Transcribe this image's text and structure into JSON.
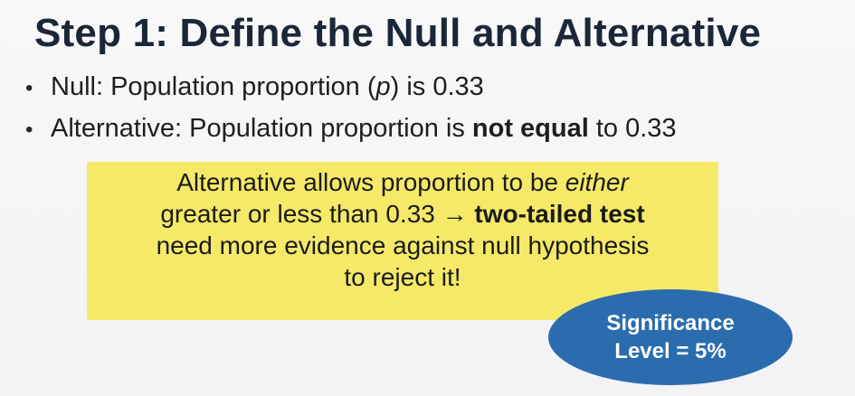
{
  "title": "Step 1: Define the Null and Alternative",
  "bullets": [
    {
      "bullet": "•",
      "prefix": "Null: Population proportion (",
      "italic": "p",
      "suffix": ") is 0.33"
    },
    {
      "bullet": "•",
      "prefix": "Alternative: Population proportion is ",
      "bold": "not equal",
      "suffix": " to 0.33"
    }
  ],
  "callout": {
    "line1_prefix": "Alternative allows proportion to be ",
    "line1_italic": "either",
    "line2_prefix": "greater or less than 0.33 → ",
    "line2_bold": "two-tailed test",
    "line3": "need more evidence against null hypothesis",
    "line4": "to reject it!"
  },
  "badge": {
    "line1": "Significance",
    "line2": "Level = 5%"
  },
  "colors": {
    "title": "#1b2638",
    "callout_background": "#f6e968",
    "badge_background": "#2b6cae"
  }
}
